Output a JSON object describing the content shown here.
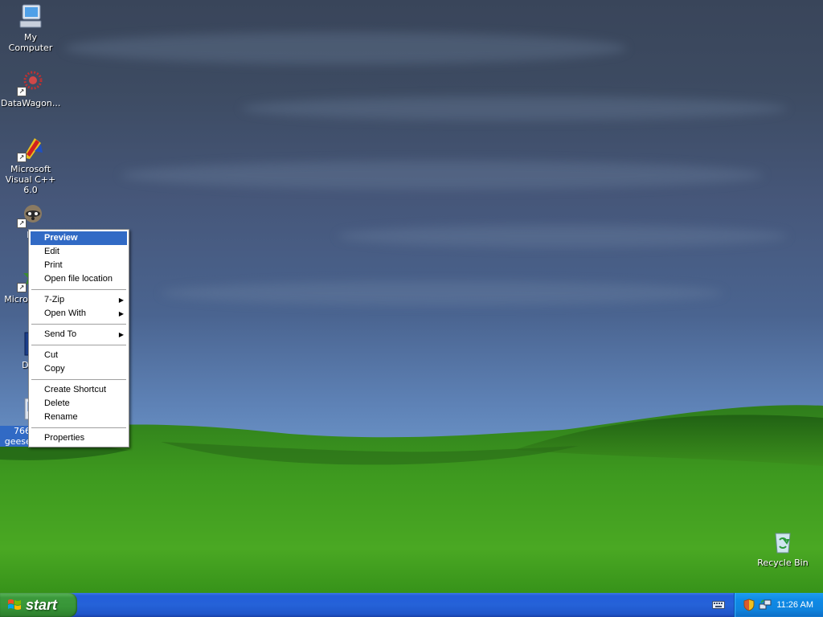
{
  "desktop": {
    "icons": [
      {
        "label": "My Computer",
        "icon": "my-computer-icon"
      },
      {
        "label": "DataWagon...",
        "icon": "datawagon-icon"
      },
      {
        "label": "Microsoft Visual C++ 6.0",
        "icon": "visual-cpp-icon"
      },
      {
        "label": "M",
        "icon": "raccoon-icon"
      },
      {
        "label": "Microso Bas",
        "icon": "visual-basic-icon"
      },
      {
        "label": "Dev",
        "icon": "dev-icon"
      },
      {
        "label": "766607 geese 1395",
        "icon": "image-file-icon",
        "selected": true
      },
      {
        "label": "Recycle Bin",
        "icon": "recycle-bin-icon"
      }
    ]
  },
  "context_menu": {
    "groups": [
      [
        {
          "label": "Preview",
          "highlighted": true
        },
        {
          "label": "Edit"
        },
        {
          "label": "Print"
        },
        {
          "label": "Open file location"
        }
      ],
      [
        {
          "label": "7-Zip",
          "submenu": true
        },
        {
          "label": "Open With",
          "submenu": true
        }
      ],
      [
        {
          "label": "Send To",
          "submenu": true
        }
      ],
      [
        {
          "label": "Cut"
        },
        {
          "label": "Copy"
        }
      ],
      [
        {
          "label": "Create Shortcut"
        },
        {
          "label": "Delete"
        },
        {
          "label": "Rename"
        }
      ],
      [
        {
          "label": "Properties"
        }
      ]
    ]
  },
  "taskbar": {
    "start_label": "start",
    "clock": "11:26 AM",
    "tray_icons": [
      "keyboard-icon",
      "security-shield-icon",
      "network-icon"
    ]
  },
  "colors": {
    "highlight": "#316ac5",
    "taskbar_blue": "#245edb",
    "start_green": "#3c9a3c",
    "tray_blue": "#0f83dd"
  }
}
